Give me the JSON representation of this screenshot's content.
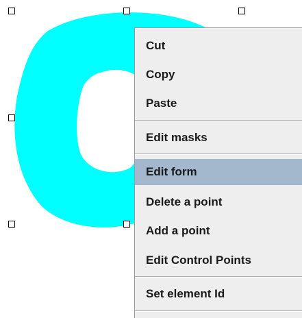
{
  "colors": {
    "shape_fill": "#00ffff",
    "menu_background": "#eeeeee",
    "menu_highlight": "#a3b8cc",
    "menu_text": "#1a1a1a"
  },
  "context_menu": {
    "items": [
      {
        "label": "Cut"
      },
      {
        "label": "Copy"
      },
      {
        "label": "Paste"
      },
      {
        "label": "Edit masks"
      },
      {
        "label": "Edit form",
        "highlighted": true
      },
      {
        "label": "Delete a point"
      },
      {
        "label": "Add a point"
      },
      {
        "label": "Edit Control Points"
      },
      {
        "label": "Set element Id"
      }
    ]
  }
}
